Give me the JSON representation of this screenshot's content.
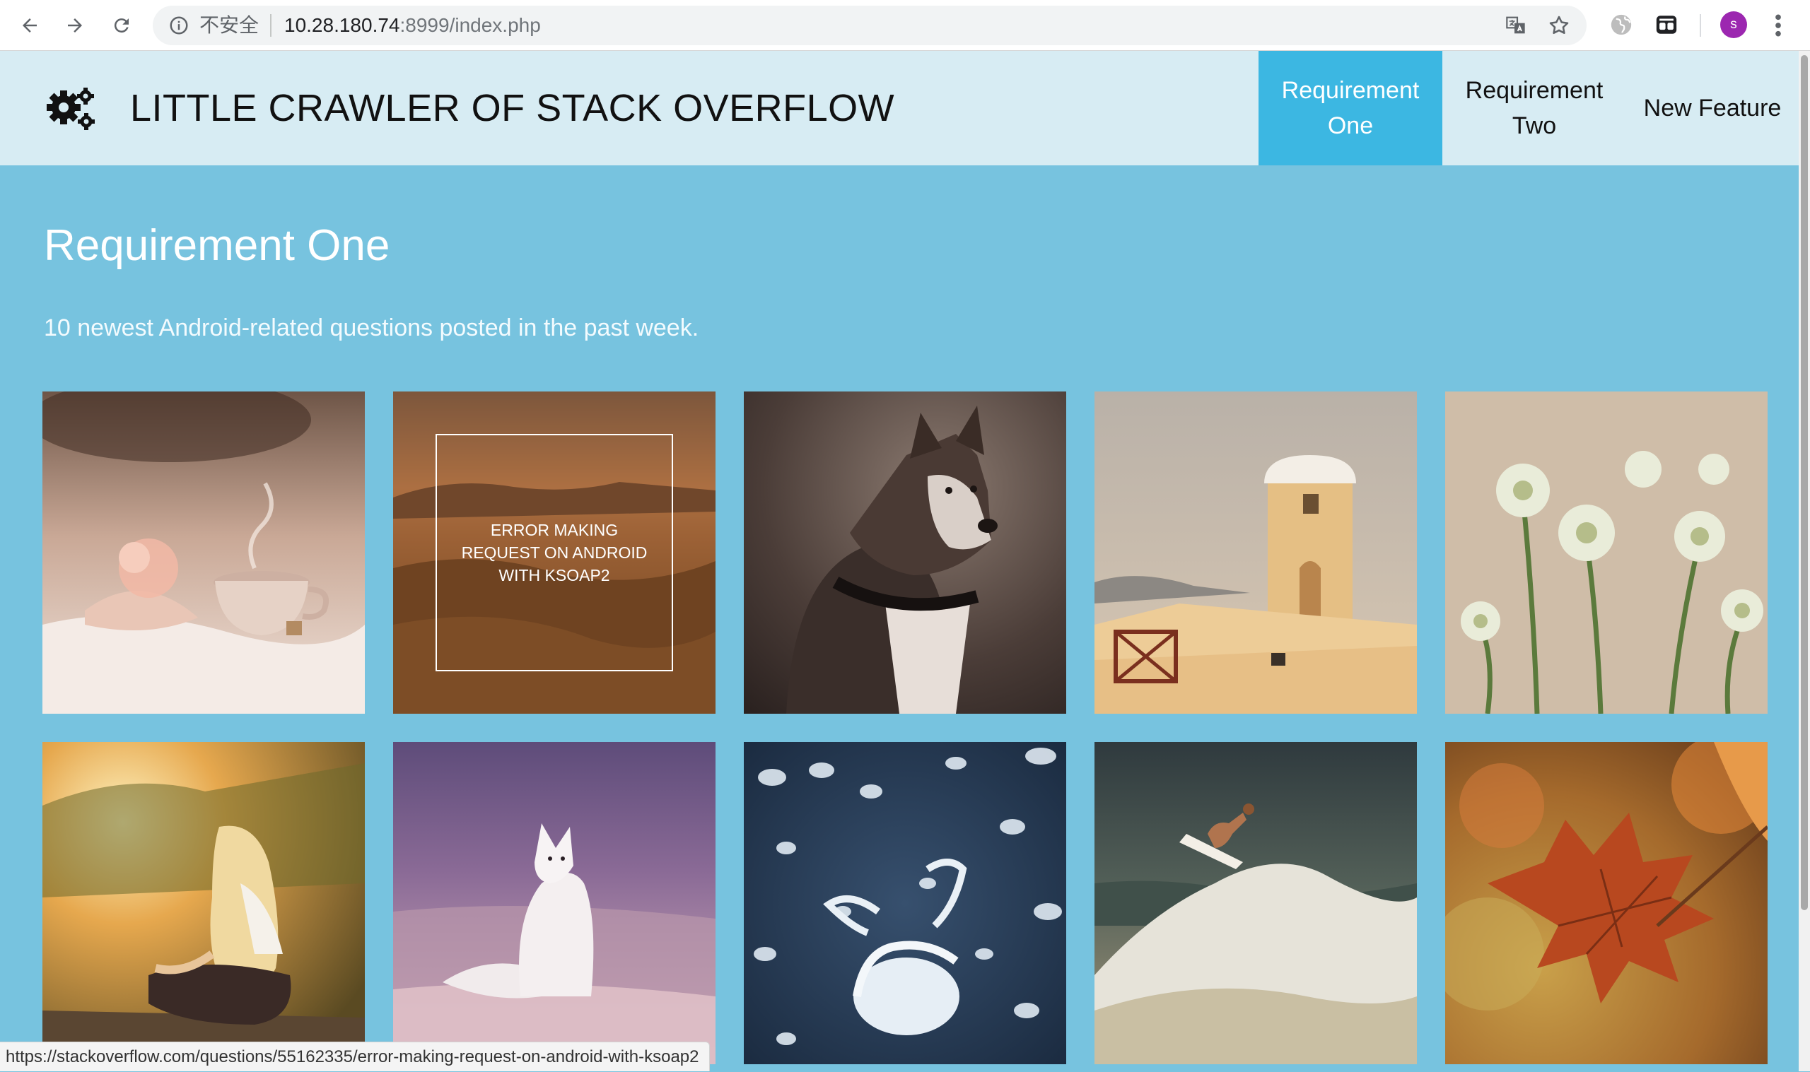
{
  "browser": {
    "security_label": "不安全",
    "url_host": "10.28.180.74",
    "url_rest": ":8999/index.php",
    "profile_initial": "s",
    "icons": {
      "back": "arrow-left-icon",
      "forward": "arrow-right-icon",
      "reload": "reload-icon",
      "info": "info-circle-icon",
      "translate": "translate-icon",
      "bookmark": "star-icon",
      "extension_one": "globe-icon",
      "extension_two": "tab-extension-icon",
      "menu": "kebab-menu-icon"
    }
  },
  "header": {
    "logo_icon": "gears-icon",
    "title": "LITTLE CRAWLER OF STACK OVERFLOW",
    "nav": [
      {
        "label_line1": "Requirement",
        "label_line2": "One",
        "active": true
      },
      {
        "label_line1": "Requirement",
        "label_line2": "Two",
        "active": false
      },
      {
        "label_line1": "New Feature",
        "label_line2": "",
        "active": false
      }
    ]
  },
  "main": {
    "heading": "Requirement One",
    "subtitle": "10 newest Android-related questions posted in the past week.",
    "tiles": [
      {
        "image": "tea-cup-photo"
      },
      {
        "image": "coastal-sunset-photo",
        "hover_caption": "ERROR MAKING REQUEST ON ANDROID WITH KSOAP2"
      },
      {
        "image": "husky-dog-photo"
      },
      {
        "image": "whitewashed-tower-photo"
      },
      {
        "image": "white-flowers-photo"
      },
      {
        "image": "girl-sunlight-photo"
      },
      {
        "image": "arctic-fox-photo"
      },
      {
        "image": "jellyfish-photo"
      },
      {
        "image": "surfer-wave-photo"
      },
      {
        "image": "autumn-leaf-photo"
      }
    ]
  },
  "status_bar": {
    "link": "https://stackoverflow.com/questions/55162335/error-making-request-on-android-with-ksoap2"
  },
  "colors": {
    "page_bg": "#77c3df",
    "header_bg": "#d7ecf3",
    "nav_active_bg": "#3cb7e2",
    "text_white": "#ffffff"
  }
}
